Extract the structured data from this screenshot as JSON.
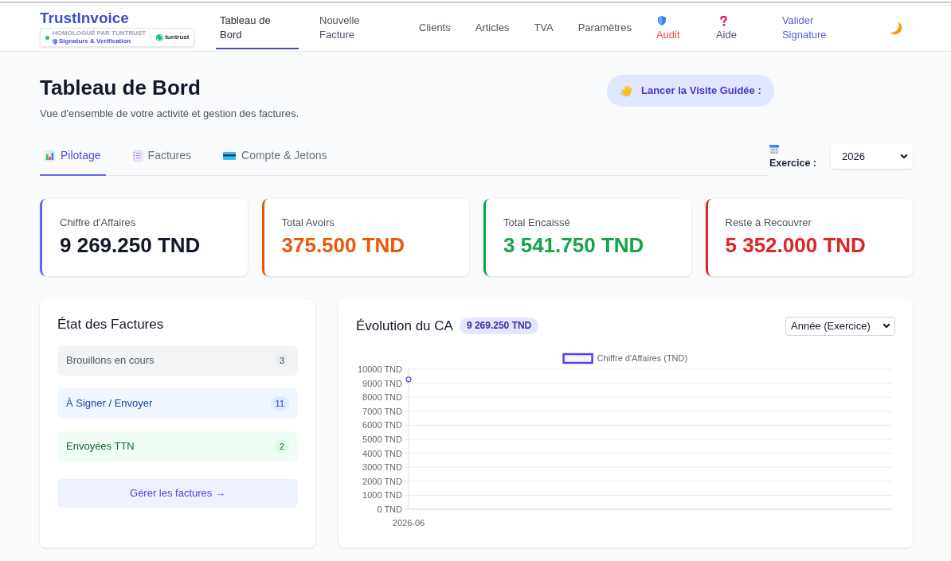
{
  "header": {
    "app_name": "TrustInvoice",
    "certification": {
      "caption": "HOMOLOGUÉ PAR TUNTRUST",
      "feature": "Signature & Verification",
      "partner": "tuntrust"
    },
    "nav": [
      {
        "label": "Tableau de Bord",
        "kind": "link",
        "selected": true
      },
      {
        "label": "Nouvelle Facture",
        "kind": "link",
        "selected": false
      },
      {
        "label": "Clients",
        "kind": "link",
        "selected": false
      },
      {
        "label": "Articles",
        "kind": "link",
        "selected": false
      },
      {
        "label": "TVA",
        "kind": "link",
        "selected": false
      },
      {
        "label": "Paramètres",
        "kind": "link",
        "selected": false
      },
      {
        "label": "Audit",
        "kind": "alert",
        "selected": false
      },
      {
        "label": "Aide",
        "kind": "help",
        "selected": false
      },
      {
        "label": "Valider Signature",
        "kind": "action",
        "selected": false
      }
    ]
  },
  "page": {
    "title": "Tableau de Bord",
    "subtitle": "Vue d'ensemble de votre activité et gestion des factures.",
    "tour_button": "Lancer la Visite Guidée :"
  },
  "tabs": [
    {
      "label": "Pilotage",
      "selected": true
    },
    {
      "label": "Factures",
      "selected": false
    },
    {
      "label": "Compte & Jetons",
      "selected": false
    }
  ],
  "fiscal_year": {
    "label": "Exercice :",
    "value": "2026"
  },
  "stats": [
    {
      "label": "Chiffre d'Affaires",
      "value": "9 269.250 TND",
      "color": "#6366f1",
      "kind": "plain"
    },
    {
      "label": "Total Avoirs",
      "value": "375.500 TND",
      "color": "#ea580c",
      "kind": "tinted"
    },
    {
      "label": "Total Encaissé",
      "value": "3 541.750 TND",
      "color": "#16a34a",
      "kind": "tinted"
    },
    {
      "label": "Reste à Recouvrer",
      "value": "5 352.000 TND",
      "color": "#dc2626",
      "kind": "tinted"
    }
  ],
  "invoice_status": {
    "title": "État des Factures",
    "items": [
      {
        "label": "Brouillons en cours",
        "count": "3",
        "kind": "neutral"
      },
      {
        "label": "À Signer / Envoyer",
        "count": "11",
        "kind": "info"
      },
      {
        "label": "Envoyées TTN",
        "count": "2",
        "kind": "success"
      }
    ],
    "button": "Gérer les factures →"
  },
  "revenue": {
    "title": "Évolution du CA",
    "total": "9 269.250 TND",
    "period": "Année (Exercice)",
    "chart_data": {
      "type": "line",
      "grid": true,
      "categories": [
        "2026-06"
      ],
      "series": [
        {
          "name": "Chiffre d'Affaires (TND)",
          "color": "#4f46e5",
          "marker": "circle",
          "values": [
            9269.25
          ]
        }
      ],
      "ylim": [
        0,
        10000
      ],
      "yticks": [
        {
          "value": 0,
          "label": "0 TND"
        },
        {
          "value": 1000,
          "label": "1000 TND"
        },
        {
          "value": 2000,
          "label": "2000 TND"
        },
        {
          "value": 3000,
          "label": "3000 TND"
        },
        {
          "value": 4000,
          "label": "4000 TND"
        },
        {
          "value": 5000,
          "label": "5000 TND"
        },
        {
          "value": 6000,
          "label": "6000 TND"
        },
        {
          "value": 7000,
          "label": "7000 TND"
        },
        {
          "value": 8000,
          "label": "8000 TND"
        },
        {
          "value": 9000,
          "label": "9000 TND"
        },
        {
          "value": 10000,
          "label": "10000 TND"
        }
      ]
    }
  }
}
